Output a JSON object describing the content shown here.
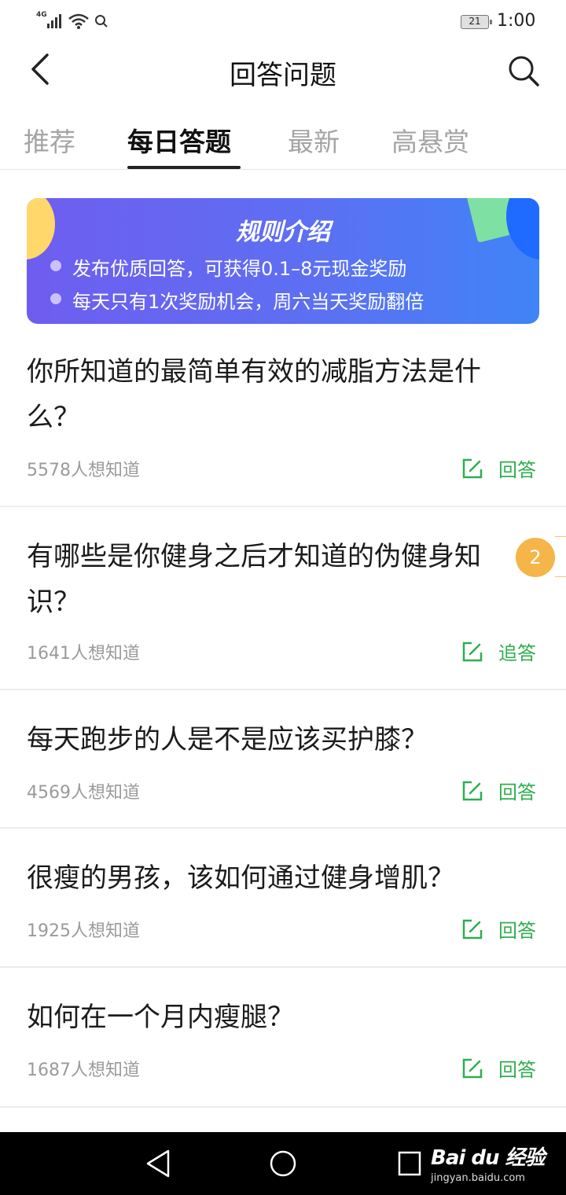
{
  "status_bar": {
    "network": "4G",
    "battery": "21",
    "time": "1:00"
  },
  "header": {
    "title": "回答问题"
  },
  "tabs": [
    {
      "label": "推荐"
    },
    {
      "label": "每日答题"
    },
    {
      "label": "最新"
    },
    {
      "label": "高悬赏"
    }
  ],
  "active_tab": "每日答题",
  "banner": {
    "title": "规则介绍",
    "rules": [
      "发布优质回答，可获得0.1–8元现金奖励",
      "每天只有1次奖励机会，周六当天奖励翻倍"
    ]
  },
  "questions": [
    {
      "title": "你所知道的最简单有效的减脂方法是什么？",
      "followers": "5578人想知道",
      "action": "回答"
    },
    {
      "title": "有哪些是你健身之后才知道的伪健身知识？",
      "followers": "1641人想知道",
      "action": "追答"
    },
    {
      "title": "每天跑步的人是不是应该买护膝？",
      "followers": "4569人想知道",
      "action": "回答"
    },
    {
      "title": "很瘦的男孩，该如何通过健身增肌？",
      "followers": "1925人想知道",
      "action": "回答"
    },
    {
      "title": "如何在一个月内瘦腿？",
      "followers": "1687人想知道",
      "action": "回答"
    }
  ],
  "floating_badge": "2",
  "watermark": {
    "logo": "Bai du 经验",
    "url": "jingyan.baidu.com"
  },
  "colors": {
    "accent_green": "#2fae4f",
    "banner_start": "#6f5df0",
    "banner_end": "#3f84f7",
    "badge": "#f5b549"
  },
  "icons": [
    "back-arrow-icon",
    "search-icon",
    "edit-icon",
    "nav-back-icon",
    "nav-home-icon",
    "nav-recents-icon"
  ]
}
